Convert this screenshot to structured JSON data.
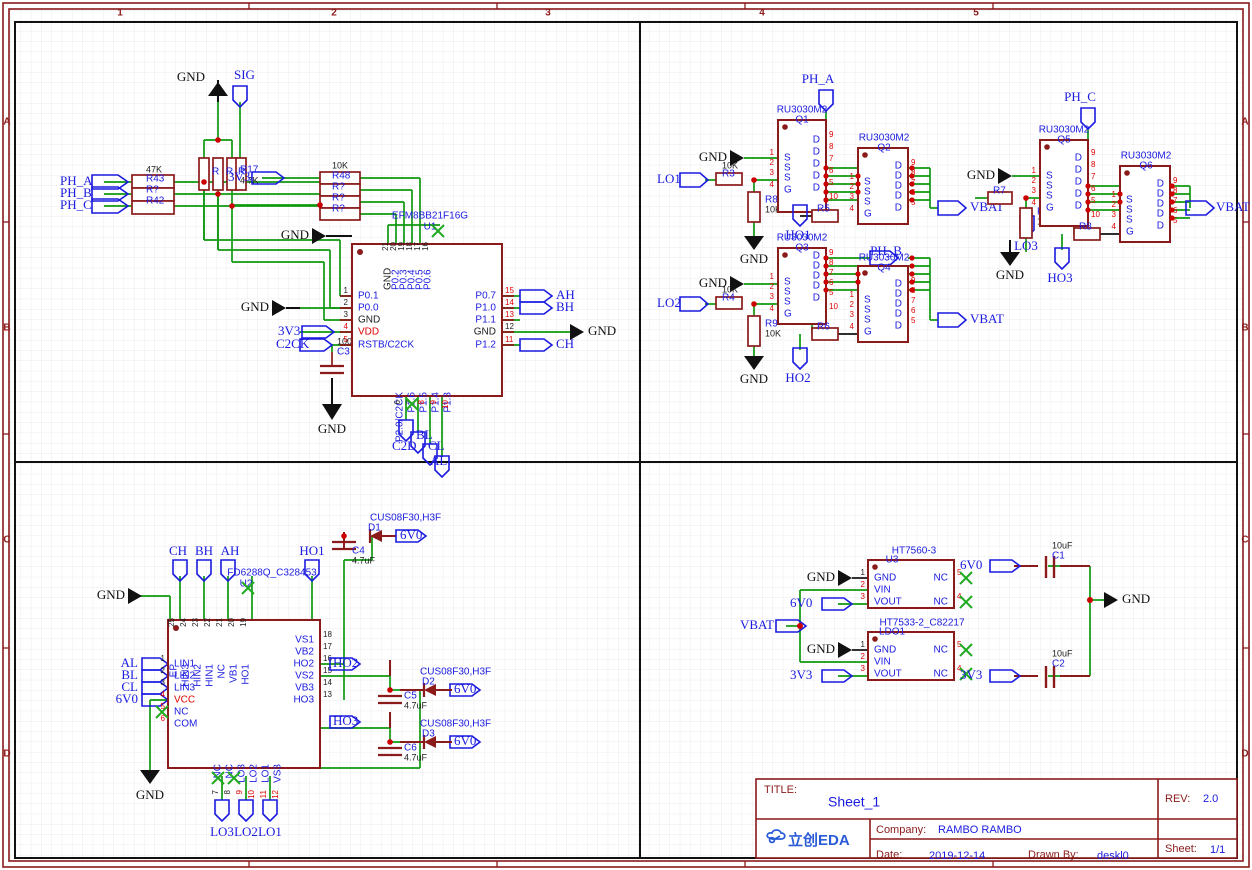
{
  "sheet": {
    "zones_top": [
      "1",
      "2",
      "3",
      "4",
      "5"
    ],
    "zones_side": [
      "A",
      "B",
      "C",
      "D"
    ]
  },
  "title_block": {
    "title_label": "TITLE:",
    "title_value": "Sheet_1",
    "rev_label": "REV:",
    "rev_value": "2.0",
    "company_label": "Company:",
    "company_value": "RAMBO RAMBO",
    "sheet_label": "Sheet:",
    "sheet_value": "1/1",
    "date_label": "Date:",
    "date_value": "2019-12-14",
    "drawn_label": "Drawn By:",
    "drawn_value": "deskl0",
    "logo_text": "立创EDA"
  },
  "quad_tl": {
    "nets": [
      "GND",
      "SIG",
      "PH_A",
      "PH_B",
      "PH_C",
      "3V3",
      "C2CK",
      "GND",
      "GND",
      "AH",
      "BH",
      "CH",
      "GND",
      "C2D",
      "CL",
      "BL",
      "AL",
      "3V3"
    ],
    "r_sig": {
      "values": [
        "R17",
        "4.7K"
      ],
      "extra": [
        "R",
        "R",
        "R"
      ]
    },
    "r_phase": {
      "value": "47K",
      "designators": [
        "R43",
        "R?",
        "R42"
      ]
    },
    "r_div": {
      "value": "10K",
      "designators": [
        "R48",
        "R?",
        "R?",
        "R?"
      ]
    },
    "mcu": {
      "name": "EFM8BB21F16G",
      "designator": "U1",
      "pins_left": [
        {
          "n": "1",
          "label": "P0.1",
          "cls": "pin"
        },
        {
          "n": "2",
          "label": "P0.0",
          "cls": "pin"
        },
        {
          "n": "3",
          "label": "GND",
          "cls": "pingnd"
        },
        {
          "n": "4",
          "label": "VDD",
          "cls": "pinpwr"
        },
        {
          "n": "5",
          "label": "RSTB/C2CK",
          "cls": "pin"
        }
      ],
      "pins_top": [
        {
          "n": "21",
          "label": "GND",
          "cls": "pingnd"
        },
        {
          "n": "20",
          "label": "P0.2",
          "cls": "pin"
        },
        {
          "n": "19",
          "label": "P0.3",
          "cls": "pin"
        },
        {
          "n": "18",
          "label": "P0.4",
          "cls": "pin"
        },
        {
          "n": "17",
          "label": "P0.5",
          "cls": "pin"
        },
        {
          "n": "16",
          "label": "P0.6",
          "cls": "pin"
        }
      ],
      "pins_right": [
        {
          "n": "15",
          "label": "P0.7",
          "cls": "pin"
        },
        {
          "n": "14",
          "label": "P1.0",
          "cls": "pin"
        },
        {
          "n": "13",
          "label": "P1.1",
          "cls": "pin"
        },
        {
          "n": "12",
          "label": "GND",
          "cls": "pingnd"
        },
        {
          "n": "11",
          "label": "P1.2",
          "cls": "pin"
        }
      ],
      "pins_bottom": [
        {
          "n": "6",
          "label": "P2.0/C2CK",
          "cls": "pin"
        },
        {
          "n": "7",
          "label": "P1.6",
          "cls": "pin"
        },
        {
          "n": "8",
          "label": "P1.5",
          "cls": "pin"
        },
        {
          "n": "9",
          "label": "P1.4",
          "cls": "pin"
        },
        {
          "n": "10",
          "label": "P1.3",
          "cls": "pin"
        }
      ]
    },
    "cap_c3": {
      "designator": "C3",
      "value": "100nF"
    }
  },
  "quad_tr": {
    "mosfet_part": "RU3030M2",
    "stages": [
      {
        "low_in": "LO1",
        "high_in": "HO1",
        "phase": "PH_A",
        "rail": "VBAT",
        "q_low": "Q1",
        "q_high": "Q2",
        "r_series": "R3",
        "r_series_val": "10K",
        "r_pull": "R8",
        "r_pull_val": "10K",
        "r_gate": "R5",
        "gnd": "GND"
      },
      {
        "low_in": "LO2",
        "high_in": "HO2",
        "phase": "PH_B",
        "rail": "VBAT",
        "q_low": "Q3",
        "q_high": "Q4",
        "r_series": "R4",
        "r_series_val": "10K",
        "r_pull": "R9",
        "r_pull_val": "10K",
        "r_gate": "R6",
        "gnd": "GND"
      },
      {
        "low_in": "LO3",
        "high_in": "HO3",
        "phase": "PH_C",
        "rail": "VBAT",
        "q_low": "Q5",
        "q_high": "Q6",
        "r_series": "R7",
        "r_series_val": "10K",
        "r_pull": "R10",
        "r_pull_val": "10K",
        "r_gate": "R8",
        "gnd": "GND"
      }
    ],
    "mosfet_pins_low": [
      "S",
      "S",
      "S",
      "G"
    ],
    "mosfet_pins_drain": [
      "D",
      "D",
      "D",
      "D",
      "D"
    ],
    "mosfet_nums_left": [
      "1",
      "2",
      "3",
      "4"
    ],
    "mosfet_nums_right": [
      "9",
      "8",
      "7",
      "6",
      "5"
    ],
    "mosfet_num_gate": "10"
  },
  "quad_bl": {
    "driver": {
      "name": "FD6288Q_C328453",
      "designator": "U2",
      "pins_left": [
        {
          "n": "1",
          "label": "LIN1",
          "cls": "pin"
        },
        {
          "n": "2",
          "label": "LIN2",
          "cls": "pin"
        },
        {
          "n": "3",
          "label": "LIN3",
          "cls": "pin"
        },
        {
          "n": "4",
          "label": "VCC",
          "cls": "pinpwr"
        },
        {
          "n": "5",
          "label": "NC",
          "cls": "pin"
        },
        {
          "n": "6",
          "label": "COM",
          "cls": "pin"
        }
      ],
      "pins_right": [
        {
          "n": "18",
          "label": "VS1",
          "cls": "pin"
        },
        {
          "n": "17",
          "label": "VB2",
          "cls": "pin"
        },
        {
          "n": "16",
          "label": "HO2",
          "cls": "pin"
        },
        {
          "n": "15",
          "label": "VS2",
          "cls": "pin"
        },
        {
          "n": "14",
          "label": "VB3",
          "cls": "pin"
        },
        {
          "n": "13",
          "label": "HO3",
          "cls": "pin"
        }
      ],
      "pins_top": [
        {
          "n": "25",
          "label": "EP",
          "cls": "pin"
        },
        {
          "n": "24",
          "label": "HIN3",
          "cls": "pin"
        },
        {
          "n": "23",
          "label": "HIN2",
          "cls": "pin"
        },
        {
          "n": "22",
          "label": "HIN1",
          "cls": "pin"
        },
        {
          "n": "21",
          "label": "NC",
          "cls": "pin"
        },
        {
          "n": "20",
          "label": "VB1",
          "cls": "pin"
        },
        {
          "n": "19",
          "label": "HO1",
          "cls": "pin"
        }
      ],
      "pins_bottom": [
        {
          "n": "7",
          "label": "NC",
          "cls": "pin"
        },
        {
          "n": "8",
          "label": "NC",
          "cls": "pin"
        },
        {
          "n": "9",
          "label": "LO3",
          "cls": "pin"
        },
        {
          "n": "10",
          "label": "LO2",
          "cls": "pin"
        },
        {
          "n": "11",
          "label": "LO1",
          "cls": "pin"
        },
        {
          "n": "12",
          "label": "VS3",
          "cls": "pin"
        }
      ]
    },
    "inputs": [
      "AL",
      "BL",
      "CL",
      "6V0"
    ],
    "top_nets": [
      "CH",
      "BH",
      "AH",
      "HO1"
    ],
    "out_nets": [
      "HO2",
      "HO3"
    ],
    "bottom_nets": [
      "LO3",
      "LO2",
      "LO1"
    ],
    "gnd_left": "GND",
    "gnd_bottom": "GND",
    "boot": [
      {
        "diode": "D1",
        "diode_part": "CUS08F30,H3F",
        "cap": "C4",
        "cap_val": "4.7uF",
        "net": "6V0"
      },
      {
        "diode": "D2",
        "diode_part": "CUS08F30,H3F",
        "cap": "C5",
        "cap_val": "4.7uF",
        "net": "6V0"
      },
      {
        "diode": "D3",
        "diode_part": "CUS08F30,H3F",
        "cap": "C6",
        "cap_val": "4.7uF",
        "net": "6V0"
      }
    ]
  },
  "quad_br": {
    "vbat_net": "VBAT",
    "gnd_right": "GND",
    "regs": [
      {
        "name": "HT7560-3",
        "designator": "U3",
        "pins_left": [
          {
            "n": "1",
            "label": "GND"
          },
          {
            "n": "2",
            "label": "VIN"
          },
          {
            "n": "3",
            "label": "VOUT"
          }
        ],
        "pins_right": [
          {
            "n": "5",
            "label": "NC"
          },
          {
            "n": "4",
            "label": "NC"
          }
        ],
        "gnd_net": "GND",
        "out_net": "6V0",
        "cap": "C1",
        "cap_val": "10uF",
        "cap_net": "6V0"
      },
      {
        "name": "HT7533-2_C82217",
        "designator": "LDO1",
        "pins_left": [
          {
            "n": "1",
            "label": "GND"
          },
          {
            "n": "2",
            "label": "VIN"
          },
          {
            "n": "3",
            "label": "VOUT"
          }
        ],
        "pins_right": [
          {
            "n": "5",
            "label": "NC"
          },
          {
            "n": "4",
            "label": "NC"
          }
        ],
        "gnd_net": "GND",
        "out_net": "3V3",
        "cap": "C2",
        "cap_val": "10uF",
        "cap_net": "3V3"
      }
    ]
  },
  "colors": {
    "wire": "#119911",
    "symbol": "#8b1a1a",
    "net_text": "#1a1ae0",
    "frame": "#8b1a1a",
    "grid": "#e8e8ec",
    "junction": "#cc0000",
    "nc_mark": "#22aa22"
  }
}
